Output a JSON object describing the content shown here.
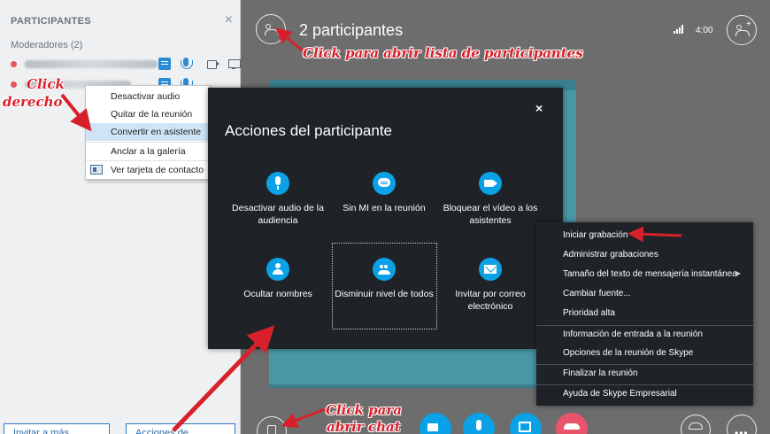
{
  "panel": {
    "title": "PARTICIPANTES",
    "close_glyph": "×",
    "section_label": "Moderadores (2)",
    "invite_button": "Invitar a más personas",
    "actions_button": "Acciones de participante"
  },
  "context_menu": {
    "items": [
      "Desactivar audio",
      "Quitar de la reunión",
      "Convertir en asistente",
      "Anclar a la galería",
      "Ver tarjeta de contacto"
    ]
  },
  "stage": {
    "participants_count": "2 participantes",
    "time": "4:00"
  },
  "dialog": {
    "title": "Acciones del participante",
    "close_glyph": "×",
    "actions": [
      {
        "label": "Desactivar audio de la audiencia",
        "icon": "microphone-icon"
      },
      {
        "label": "Sin MI en la reunión",
        "icon": "chat-bubble-icon"
      },
      {
        "label": "Bloquear el vídeo a los asistentes",
        "icon": "video-camera-icon"
      },
      {
        "label": "Ocultar nombres",
        "icon": "person-icon"
      },
      {
        "label": "Disminuir nivel de todos",
        "icon": "group-icon"
      },
      {
        "label": "Invitar por correo electrónico",
        "icon": "mail-icon"
      }
    ]
  },
  "more_menu": {
    "items": [
      "Iniciar grabación",
      "Administrar grabaciones",
      "Tamaño del texto de mensajería instantánea",
      "Cambiar fuente...",
      "Prioridad alta",
      "Información de entrada a la reunión",
      "Opciones de la reunión de Skype",
      "Finalizar la reunión",
      "Ayuda de Skype Empresarial"
    ]
  },
  "annotations": {
    "click_participants_list": "Click para abrir lista de participantes",
    "right_click_1": "Click",
    "right_click_2": "derecho",
    "click_chat_1": "Click para",
    "click_chat_2": "abrir chat"
  },
  "colors": {
    "accent": "#0aa1e6",
    "annotation": "#d8202b",
    "stage_bg": "#6d6d6d",
    "dialog_bg": "#1f2327",
    "video_tile": "#4a97a6",
    "end_call": "#e9546b"
  }
}
